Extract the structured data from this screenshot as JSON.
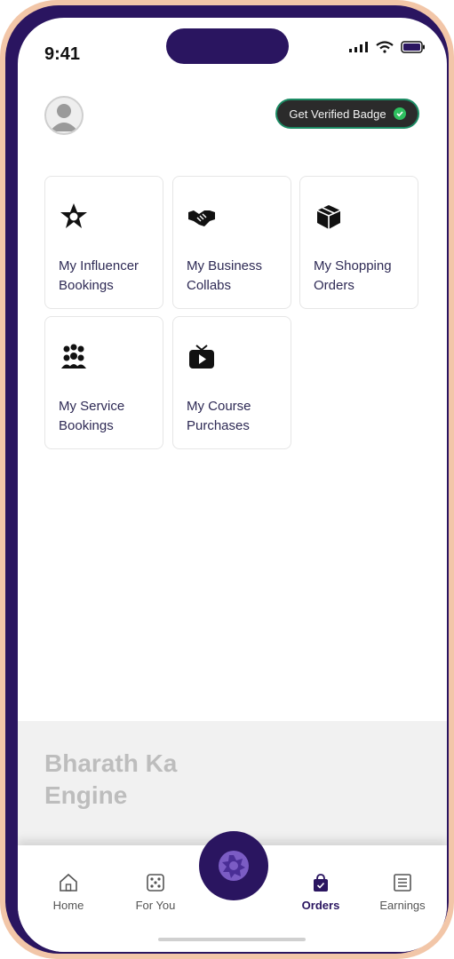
{
  "status": {
    "time": "9:41"
  },
  "header": {
    "verified_badge_label": "Get Verified Badge"
  },
  "cards": [
    {
      "label": "My Influencer Bookings",
      "icon": "star-badge-icon"
    },
    {
      "label": "My Business Collabs",
      "icon": "handshake-icon"
    },
    {
      "label": "My Shopping Orders",
      "icon": "box-icon"
    },
    {
      "label": "My Service Bookings",
      "icon": "group-icon"
    },
    {
      "label": "My Course Purchases",
      "icon": "tv-play-icon"
    }
  ],
  "banner": {
    "line1": "Bharath Ka",
    "line2": "Engine"
  },
  "nav": {
    "items": [
      {
        "label": "Home",
        "icon": "home-icon"
      },
      {
        "label": "For You",
        "icon": "dice-icon"
      },
      {
        "label": "Orders",
        "icon": "shopping-bag-icon",
        "active": true
      },
      {
        "label": "Earnings",
        "icon": "receipt-icon"
      }
    ]
  },
  "colors": {
    "brand": "#2a1560",
    "badge_check": "#2ec05f"
  }
}
